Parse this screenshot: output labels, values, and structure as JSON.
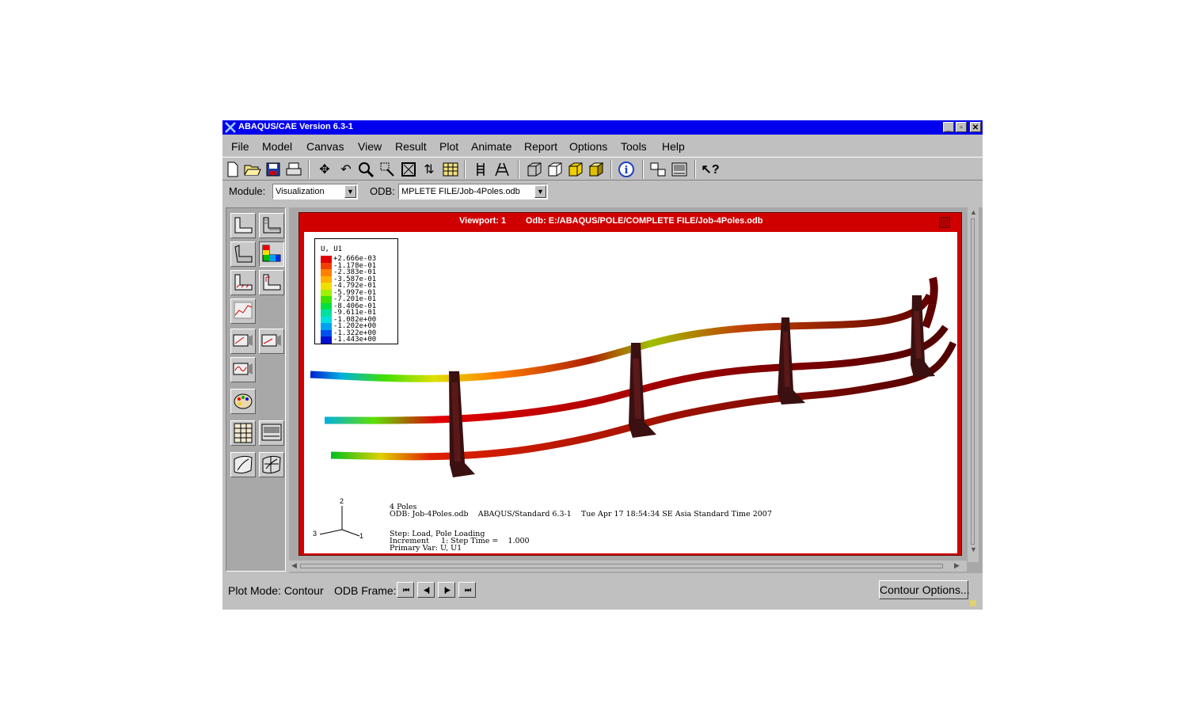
{
  "window": {
    "title": "ABAQUS/CAE Version 6.3-1",
    "controls": [
      "_",
      "▫",
      "✕"
    ]
  },
  "menu": [
    "File",
    "Model",
    "Canvas",
    "View",
    "Result",
    "Plot",
    "Animate",
    "Report",
    "Options",
    "Tools",
    "Help"
  ],
  "toolbar_icons": [
    "new-file-icon",
    "open-file-icon",
    "save-icon",
    "print-icon",
    "pan-icon",
    "rotate-icon",
    "zoom-icon",
    "box-zoom-icon",
    "fit-icon",
    "swap-icon",
    "table-icon",
    "parallel-icon",
    "perspective-icon",
    "iso-view-icon",
    "box-view-icon",
    "front-view-icon",
    "shaded-view-icon",
    "info-icon",
    "layout-icon",
    "display-icon",
    "help-pointer-icon"
  ],
  "module_row": {
    "module_label": "Module:",
    "module_value": "Visualization",
    "odb_label": "ODB:",
    "odb_value": "MPLETE FILE/Job-4Poles.odb"
  },
  "viewport": {
    "title_left": "Viewport: 1",
    "title_right": "Odb: E:/ABAQUS/POLE/COMPLETE FILE/Job-4Poles.odb"
  },
  "legend": {
    "title": "U, U1",
    "entries": [
      {
        "value": "+2.666e-03",
        "color": "#e00000"
      },
      {
        "value": "-1.178e-01",
        "color": "#f04000"
      },
      {
        "value": "-2.383e-01",
        "color": "#ff8000"
      },
      {
        "value": "-3.587e-01",
        "color": "#ffb000"
      },
      {
        "value": "-4.792e-01",
        "color": "#f0e000"
      },
      {
        "value": "-5.997e-01",
        "color": "#a0f000"
      },
      {
        "value": "-7.201e-01",
        "color": "#40e000"
      },
      {
        "value": "-8.406e-01",
        "color": "#00e040"
      },
      {
        "value": "-9.611e-01",
        "color": "#00e0a0"
      },
      {
        "value": "-1.082e+00",
        "color": "#00e0e0"
      },
      {
        "value": "-1.202e+00",
        "color": "#00a0f0"
      },
      {
        "value": "-1.322e+00",
        "color": "#0050f0"
      },
      {
        "value": "-1.443e+00",
        "color": "#0010d0"
      }
    ]
  },
  "info": {
    "line1": "4 Poles",
    "line2": "ODB: Job-4Poles.odb    ABAQUS/Standard 6.3-1    Tue Apr 17 18:54:34 SE Asia Standard Time 2007",
    "line3": "Step: Load, Pole Loading",
    "line4": "Increment     1: Step Time =    1.000",
    "line5": "Primary Var: U, U1"
  },
  "triad": {
    "axis2": "2",
    "axis3": "3",
    "axis1": "1"
  },
  "status": {
    "plot_mode": "Plot Mode: Contour",
    "odb_frame": "ODB Frame:",
    "frame_buttons": [
      "⏮",
      "◀|",
      "|▶",
      "⏭"
    ],
    "contour_options": "Contour Options..."
  }
}
